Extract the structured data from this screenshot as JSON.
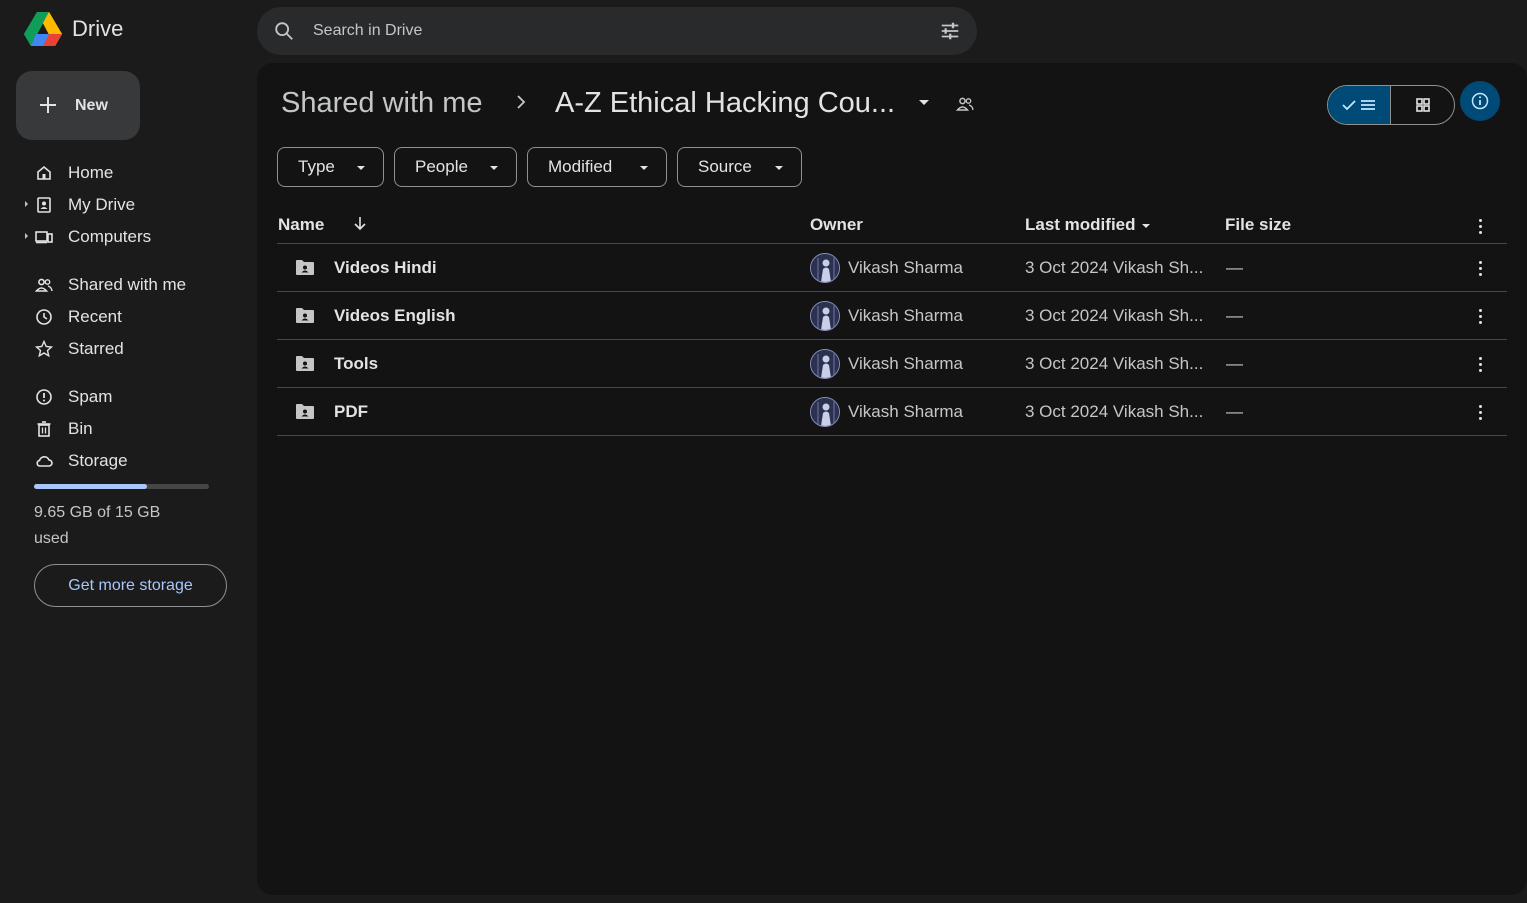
{
  "app": {
    "title": "Drive"
  },
  "search": {
    "placeholder": "Search in Drive"
  },
  "sidebar": {
    "new_label": "New",
    "items": [
      {
        "label": "Home",
        "icon": "home-icon"
      },
      {
        "label": "My Drive",
        "icon": "my-drive-icon"
      },
      {
        "label": "Computers",
        "icon": "computers-icon"
      },
      {
        "label": "Shared with me",
        "icon": "shared-icon"
      },
      {
        "label": "Recent",
        "icon": "clock-icon"
      },
      {
        "label": "Starred",
        "icon": "star-icon"
      },
      {
        "label": "Spam",
        "icon": "spam-icon"
      },
      {
        "label": "Bin",
        "icon": "bin-icon"
      },
      {
        "label": "Storage",
        "icon": "cloud-icon"
      }
    ],
    "storage": {
      "used_text": "9.65 GB of 15 GB used",
      "used_fraction": 0.643,
      "button_label": "Get more storage"
    }
  },
  "main": {
    "breadcrumb": {
      "root": "Shared with me",
      "current": "A-Z Ethical Hacking Cou..."
    },
    "filters": [
      "Type",
      "People",
      "Modified",
      "Source"
    ],
    "columns": {
      "name": "Name",
      "owner": "Owner",
      "modified": "Last modified",
      "size": "File size"
    },
    "rows": [
      {
        "name": "Videos Hindi",
        "owner": "Vikash Sharma",
        "modified": "3 Oct 2024 Vikash Sh...",
        "size": "—"
      },
      {
        "name": "Videos English",
        "owner": "Vikash Sharma",
        "modified": "3 Oct 2024 Vikash Sh...",
        "size": "—"
      },
      {
        "name": "Tools",
        "owner": "Vikash Sharma",
        "modified": "3 Oct 2024 Vikash Sh...",
        "size": "—"
      },
      {
        "name": "PDF",
        "owner": "Vikash Sharma",
        "modified": "3 Oct 2024 Vikash Sh...",
        "size": "—"
      }
    ]
  },
  "colors": {
    "background": "#1b1b1b",
    "panel": "#131314",
    "accent": "#a8c7fa",
    "selected": "#004a77"
  }
}
